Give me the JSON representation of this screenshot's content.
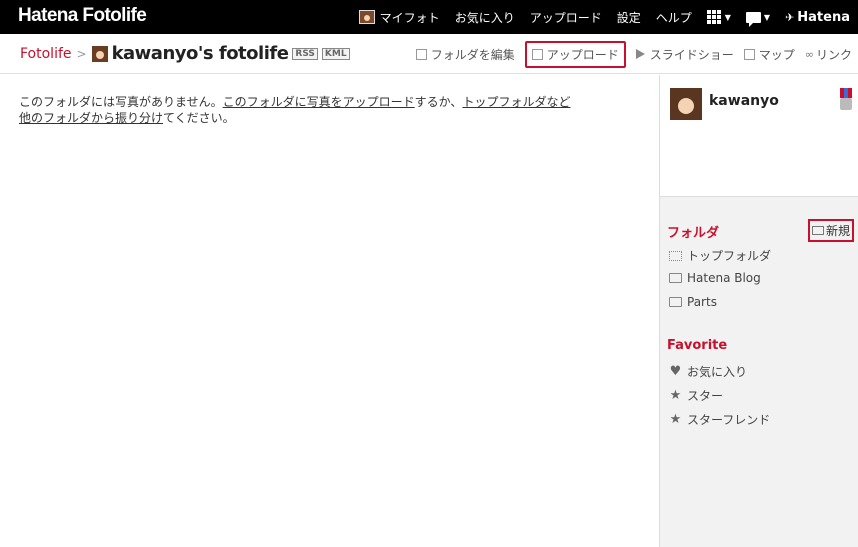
{
  "topbar": {
    "logo": "Hatena Fotolife",
    "nav": {
      "my_photo": "マイフォト",
      "favorites": "お気に入り",
      "upload": "アップロード",
      "settings": "設定",
      "help": "ヘルプ",
      "brand": "Hatena"
    }
  },
  "header": {
    "home_link": "Fotolife",
    "separator": ">",
    "title": "kawanyo's fotolife",
    "rss_tag": "RSS",
    "kml_tag": "KML",
    "actions": {
      "edit_folder": "フォルダを編集",
      "upload": "アップロード",
      "slideshow": "スライドショー",
      "map": "マップ",
      "link": "リンク"
    }
  },
  "main": {
    "message_part1": "このフォルダには写真がありません。",
    "message_link1": "このフォルダに写真をアップロード",
    "message_part2": "するか、",
    "message_link2": "トップフォルダなど他のフォルダから振り分け",
    "message_part3": "てください。"
  },
  "sidebar": {
    "username": "kawanyo",
    "folders_title": "フォルダ",
    "new_button": "新規",
    "folders": [
      "トップフォルダ",
      "Hatena Blog",
      "Parts"
    ],
    "favorite_title": "Favorite",
    "favorites": [
      "お気に入り",
      "スター",
      "スターフレンド"
    ]
  },
  "colors": {
    "accent": "#c8102e",
    "topbar": "#000000",
    "sidebar_bg": "#f2f2f2"
  }
}
